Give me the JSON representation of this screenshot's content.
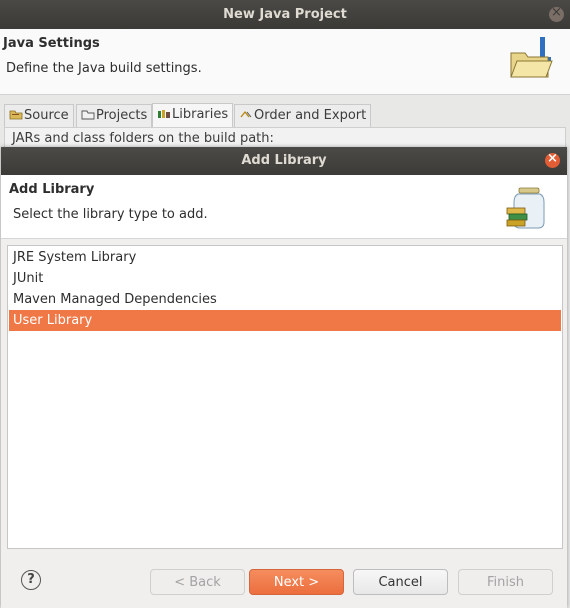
{
  "outer": {
    "title": "New Java Project",
    "header_title": "Java Settings",
    "header_desc": "Define the Java build settings.",
    "tabs": [
      {
        "label": "Source",
        "icon": "source-folder-icon"
      },
      {
        "label": "Projects",
        "icon": "projects-folder-icon"
      },
      {
        "label": "Libraries",
        "icon": "libraries-icon"
      },
      {
        "label": "Order and Export",
        "icon": "order-export-icon"
      }
    ],
    "tab_content_text": "JARs and class folders on the build path:"
  },
  "dialog": {
    "title": "Add Library",
    "header_title": "Add Library",
    "header_desc": "Select the library type to add.",
    "items": [
      "JRE System Library",
      "JUnit",
      "Maven Managed Dependencies",
      "User Library"
    ],
    "selected_index": 3,
    "buttons": {
      "back": "< Back",
      "next": "Next >",
      "cancel": "Cancel",
      "finish": "Finish"
    },
    "help": "?"
  },
  "colors": {
    "accent": "#f07746",
    "titlebar": "#3c3b38",
    "close_active": "#e25d33"
  }
}
